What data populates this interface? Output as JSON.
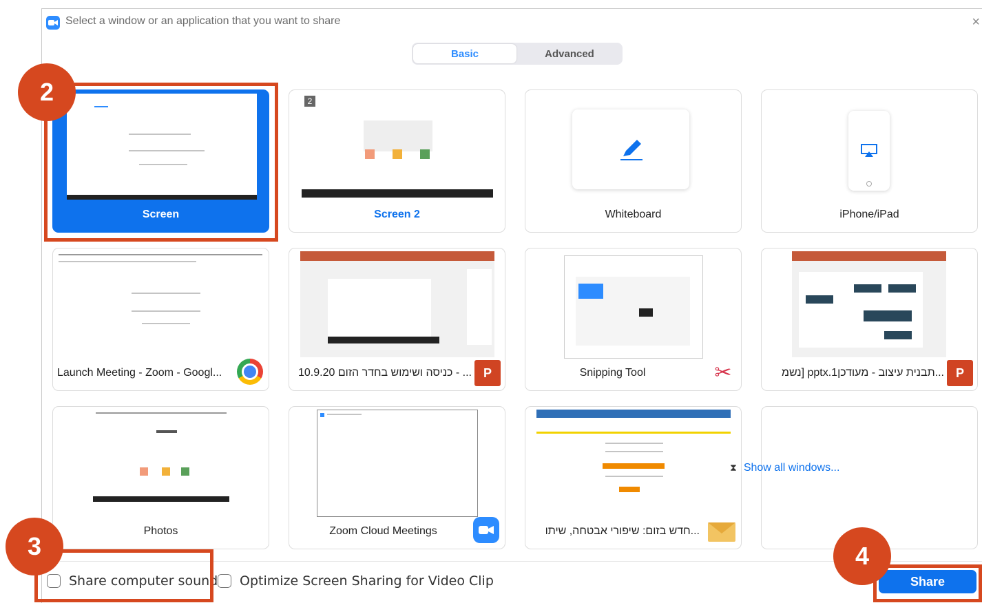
{
  "dialog": {
    "title": "Select a window or an application that you want to share",
    "close_glyph": "×",
    "tabs": [
      {
        "label": "Basic",
        "active": true
      },
      {
        "label": "Advanced",
        "active": false
      }
    ]
  },
  "tiles": [
    {
      "label": "Screen",
      "selected": true
    },
    {
      "label": "Screen 2",
      "badge": "2"
    },
    {
      "label": "Whiteboard"
    },
    {
      "label": "iPhone/iPad"
    },
    {
      "label": "Launch Meeting - Zoom - Googl...",
      "icon": "chrome-icon"
    },
    {
      "label": "10.9.20 כניסה ושימוש בחדר הזום - ...",
      "icon": "powerpoint-icon",
      "icon_text": "P"
    },
    {
      "label": "Snipping Tool",
      "icon": "snipping-tool-icon",
      "icon_text": "✂"
    },
    {
      "label": "נשמ] pptx.1תבנית עיצוב - מעודכן...",
      "icon": "powerpoint-icon",
      "icon_text": "P"
    },
    {
      "label": "Photos"
    },
    {
      "label": "Zoom Cloud Meetings",
      "icon": "zoom-icon"
    },
    {
      "label": "חדש בזום: שיפורי אבטחה, שיתו...",
      "icon": "mail-icon"
    }
  ],
  "show_all": {
    "label": "Show all windows...",
    "icon_glyph": "⧗"
  },
  "footer": {
    "share_sound_label": "Share computer sound",
    "optimize_label": "Optimize Screen Sharing for Video Clip",
    "share_sound_checked": false,
    "optimize_checked": false,
    "share_button": "Share"
  },
  "callouts": [
    "2",
    "3",
    "4"
  ],
  "colors": {
    "accent": "#0e72ed",
    "callout": "#d6481f",
    "zoom_icon": "#2d8cff"
  }
}
